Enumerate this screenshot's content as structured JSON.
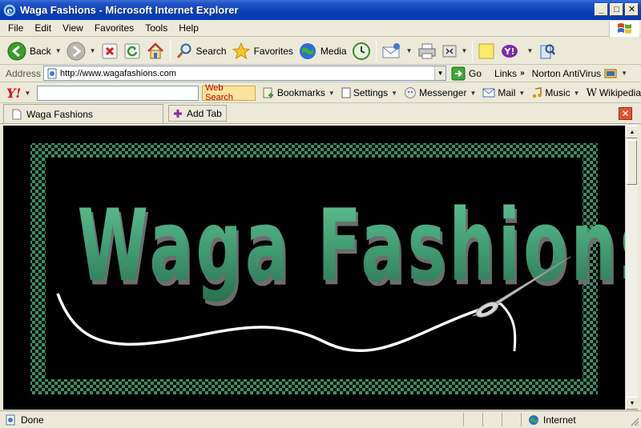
{
  "window": {
    "title": "Waga Fashions - Microsoft Internet Explorer",
    "controls": [
      "_",
      "□",
      "✕"
    ]
  },
  "menu": [
    "File",
    "Edit",
    "View",
    "Favorites",
    "Tools",
    "Help"
  ],
  "toolbar": {
    "back": "Back",
    "search": "Search",
    "favorites": "Favorites",
    "media": "Media"
  },
  "address": {
    "label": "Address",
    "url": "http://www.wagafashions.com",
    "go": "Go",
    "links": "Links",
    "norton": "Norton AntiVirus"
  },
  "yahoo": {
    "logo": "Y!",
    "search_value": "",
    "web_search": "Web Search",
    "bookmarks": "Bookmarks",
    "settings": "Settings",
    "messenger": "Messenger",
    "mail": "Mail",
    "music": "Music",
    "wikipedia": "Wikipedia"
  },
  "tabs": {
    "items": [
      {
        "label": "Waga Fashions"
      }
    ],
    "add": "Add Tab"
  },
  "page": {
    "banner_text": "Waga Fashions",
    "colors": {
      "background": "#000000",
      "lettering": "#3f9a72",
      "border_check": "#3c8f67"
    }
  },
  "status": {
    "text": "Done",
    "zone": "Internet"
  }
}
